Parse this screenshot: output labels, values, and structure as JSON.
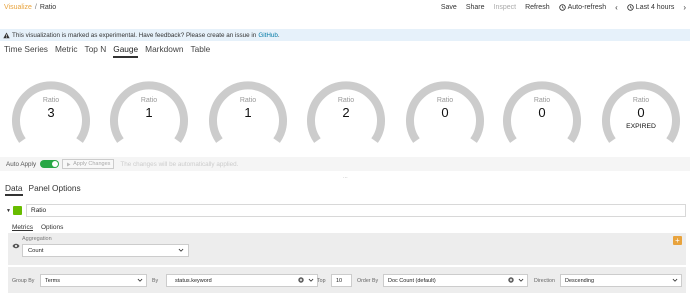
{
  "breadcrumb": {
    "parent": "Visualize",
    "separator": "/",
    "current": "Ratio"
  },
  "topnav": {
    "save": "Save",
    "share": "Share",
    "inspect": "Inspect",
    "refresh": "Refresh",
    "auto_refresh": "Auto-refresh",
    "time_range": "Last 4 hours"
  },
  "banner": {
    "text": "This visualization is marked as experimental. Have feedback? Please create an issue in",
    "link": "GitHub",
    "suffix": "."
  },
  "type_tabs": [
    "Time Series",
    "Metric",
    "Top N",
    "Gauge",
    "Markdown",
    "Table"
  ],
  "active_type_tab": "Gauge",
  "gauges": [
    {
      "label": "Ratio",
      "value": "3",
      "sub": ""
    },
    {
      "label": "Ratio",
      "value": "1",
      "sub": ""
    },
    {
      "label": "Ratio",
      "value": "1",
      "sub": ""
    },
    {
      "label": "Ratio",
      "value": "2",
      "sub": ""
    },
    {
      "label": "Ratio",
      "value": "0",
      "sub": ""
    },
    {
      "label": "Ratio",
      "value": "0",
      "sub": ""
    },
    {
      "label": "Ratio",
      "value": "0",
      "sub": "EXPIRED"
    }
  ],
  "apply_bar": {
    "auto_apply_label": "Auto Apply",
    "apply_button": "Apply Changes",
    "note": "The changes will be automatically applied."
  },
  "editor": {
    "tabs": [
      "Data",
      "Panel Options"
    ],
    "series_label": "Ratio",
    "series_color": "#68bc00",
    "sub_tabs": [
      "Metrics",
      "Options"
    ],
    "aggregation_label": "Aggregation",
    "aggregation_value": "Count",
    "group_by": {
      "group_by_label": "Group By",
      "group_by_value": "Terms",
      "by_label": "By",
      "by_value": "status.keyword",
      "top_label": "Top",
      "top_value": "10",
      "order_by_label": "Order By",
      "order_by_value": "Doc Count (default)",
      "direction_label": "Direction",
      "direction_value": "Descending"
    }
  },
  "colors": {
    "accent": "#e8a33d",
    "gauge_track": "#cccccc",
    "toggle_on": "#28a745",
    "link": "#0079a5"
  }
}
